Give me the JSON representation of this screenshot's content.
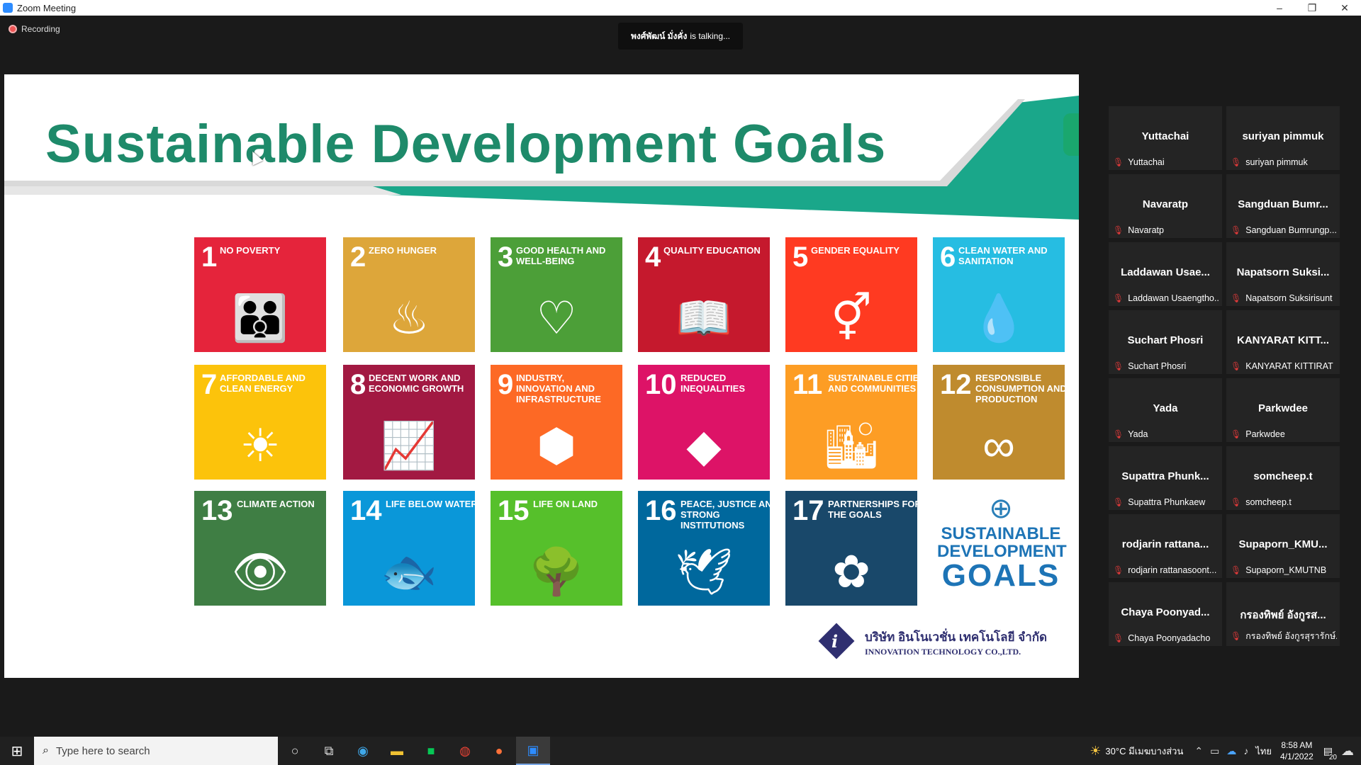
{
  "window": {
    "title": "Zoom Meeting",
    "minimize": "–",
    "restore": "❐",
    "close": "✕"
  },
  "recording": {
    "label": "Recording"
  },
  "talking": {
    "name": "พงศ์พัฒน์ มั่งคั่ง",
    "suffix": "is talking..."
  },
  "slide": {
    "headline": "Sustainable Development Goals",
    "company_thai": "บริษัท อินโนเวชั่น เทคโนโลยี จำกัด",
    "company_en": "INNOVATION TECHNOLOGY CO.,LTD.",
    "logo_line1": "SUSTAINABLE",
    "logo_line2": "DEVELOPMENT",
    "logo_line3": "GOALS",
    "tiles": [
      {
        "num": "1",
        "title": "No Poverty",
        "color": "#e5243b",
        "glyph": "👪"
      },
      {
        "num": "2",
        "title": "Zero Hunger",
        "color": "#dda63a",
        "glyph": "♨"
      },
      {
        "num": "3",
        "title": "Good Health and Well-Being",
        "color": "#4c9f38",
        "glyph": "♡"
      },
      {
        "num": "4",
        "title": "Quality Education",
        "color": "#c5192d",
        "glyph": "📖"
      },
      {
        "num": "5",
        "title": "Gender Equality",
        "color": "#ff3a21",
        "glyph": "⚥"
      },
      {
        "num": "6",
        "title": "Clean Water and Sanitation",
        "color": "#26bde2",
        "glyph": "💧"
      },
      {
        "num": "7",
        "title": "Affordable and Clean Energy",
        "color": "#fcc30b",
        "glyph": "☀"
      },
      {
        "num": "8",
        "title": "Decent Work and Economic Growth",
        "color": "#a21942",
        "glyph": "📈"
      },
      {
        "num": "9",
        "title": "Industry, Innovation and Infrastructure",
        "color": "#fd6925",
        "glyph": "⬢"
      },
      {
        "num": "10",
        "title": "Reduced Inequalities",
        "color": "#dd1367",
        "glyph": "◆"
      },
      {
        "num": "11",
        "title": "Sustainable Cities and Communities",
        "color": "#fd9d24",
        "glyph": "🏙"
      },
      {
        "num": "12",
        "title": "Responsible Consumption and Production",
        "color": "#bf8b2e",
        "glyph": "∞"
      },
      {
        "num": "13",
        "title": "Climate Action",
        "color": "#3f7e44",
        "glyph": "👁"
      },
      {
        "num": "14",
        "title": "Life Below Water",
        "color": "#0a97d9",
        "glyph": "🐟"
      },
      {
        "num": "15",
        "title": "Life On Land",
        "color": "#56c02b",
        "glyph": "🌳"
      },
      {
        "num": "16",
        "title": "Peace, Justice and Strong Institutions",
        "color": "#00689d",
        "glyph": "🕊"
      },
      {
        "num": "17",
        "title": "Partnerships for the Goals",
        "color": "#19486a",
        "glyph": "✿"
      }
    ]
  },
  "participants": [
    {
      "name": "Yuttachai",
      "label": "Yuttachai"
    },
    {
      "name": "suriyan pimmuk",
      "label": "suriyan pimmuk"
    },
    {
      "name": "Navaratp",
      "label": "Navaratp"
    },
    {
      "name": "Sangduan  Bumr...",
      "label": "Sangduan Bumrungp..."
    },
    {
      "name": "Laddawan  Usae...",
      "label": "Laddawan Usaengtho..."
    },
    {
      "name": "Napatsorn  Suksi...",
      "label": "Napatsorn Suksirisunt"
    },
    {
      "name": "Suchart Phosri",
      "label": "Suchart Phosri"
    },
    {
      "name": "KANYARAT  KITT...",
      "label": "KANYARAT KITTIRAT"
    },
    {
      "name": "Yada",
      "label": "Yada"
    },
    {
      "name": "Parkwdee",
      "label": "Parkwdee"
    },
    {
      "name": "Supattra  Phunk...",
      "label": "Supattra Phunkaew"
    },
    {
      "name": "somcheep.t",
      "label": "somcheep.t"
    },
    {
      "name": "rodjarin  rattana...",
      "label": "rodjarin rattanasoont..."
    },
    {
      "name": "Supaporn_KMU...",
      "label": "Supaporn_KMUTNB"
    },
    {
      "name": "Chaya  Poonyad...",
      "label": "Chaya Poonyadacho"
    },
    {
      "name": "กรองทิพย์ อังกูรส...",
      "label": "กรองทิพย์ อังกูรสุรารักษ์..."
    }
  ],
  "taskbar": {
    "search_placeholder": "Type here to search",
    "weather": "30°C  มีเมฆบางส่วน",
    "lang": "ไทย",
    "time": "8:58 AM",
    "date": "4/1/2022",
    "notif_count": "20"
  }
}
